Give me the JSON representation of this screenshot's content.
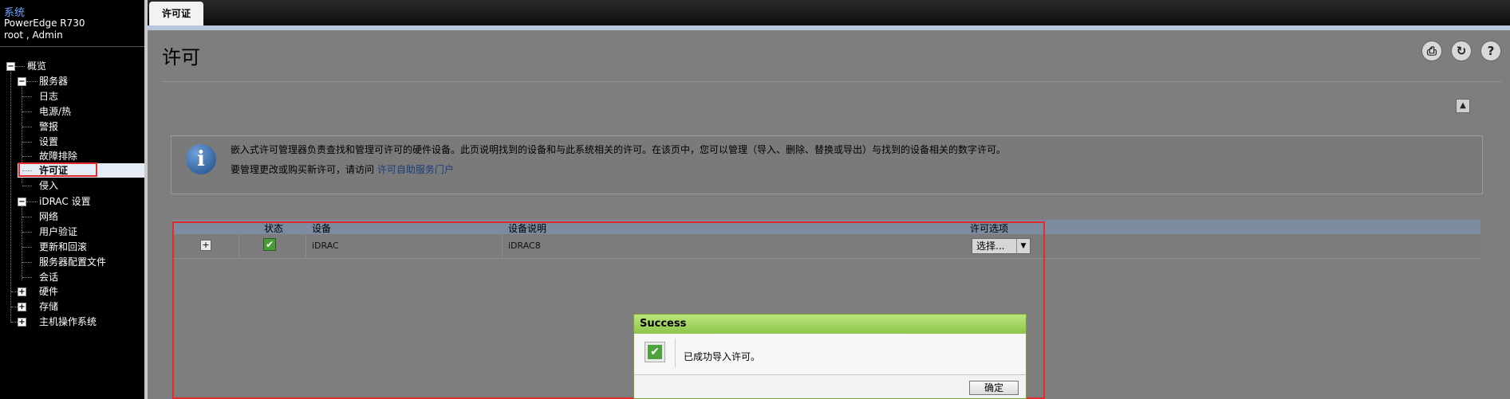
{
  "sidebar": {
    "title": "系统",
    "model": "PowerEdge R730",
    "user": "root , Admin",
    "tree": {
      "overview": "概览",
      "server": "服务器",
      "log": "日志",
      "power_thermal": "电源/热",
      "alerts": "警报",
      "setup": "设置",
      "troubleshooting": "故障排除",
      "licenses": "许可证",
      "intrusion": "侵入",
      "idrac_settings": "iDRAC 设置",
      "network": "网络",
      "user_auth": "用户验证",
      "update_rollback": "更新和回滚",
      "server_profile": "服务器配置文件",
      "sessions": "会话",
      "hardware": "硬件",
      "storage": "存储",
      "host_os": "主机操作系统"
    }
  },
  "tabs": {
    "active": "许可证"
  },
  "page": {
    "title": "许可",
    "info_text_1": "嵌入式许可管理器负责查找和管理可许可的硬件设备。此页说明找到的设备和与此系统相关的许可。在该页中，您可以管理（导入、删除、替换或导出）与找到的设备相关的数字许可。",
    "info_text_2_prefix": "要管理更改或购买新许可，请访问",
    "info_link": "许可自助服务门户"
  },
  "table": {
    "headers": {
      "status": "状态",
      "device": "设备",
      "description": "设备说明",
      "license_options": "许可选项"
    },
    "row": {
      "expand": "+",
      "device": "iDRAC",
      "description": "iDRAC8",
      "option": "选择..."
    }
  },
  "dialog": {
    "title": "Success",
    "message": "已成功导入许可。",
    "ok_label": "确定"
  },
  "icons": {
    "info": "info-icon",
    "print": "print-icon",
    "refresh": "refresh-icon",
    "help": "help-icon",
    "collapse": "collapse-up-icon",
    "success": "check-icon"
  },
  "colors": {
    "annotation_red": "#e32b2b",
    "dialog_header_green": "#8dc44a",
    "selected_tree_bg": "#e6ecf5"
  }
}
